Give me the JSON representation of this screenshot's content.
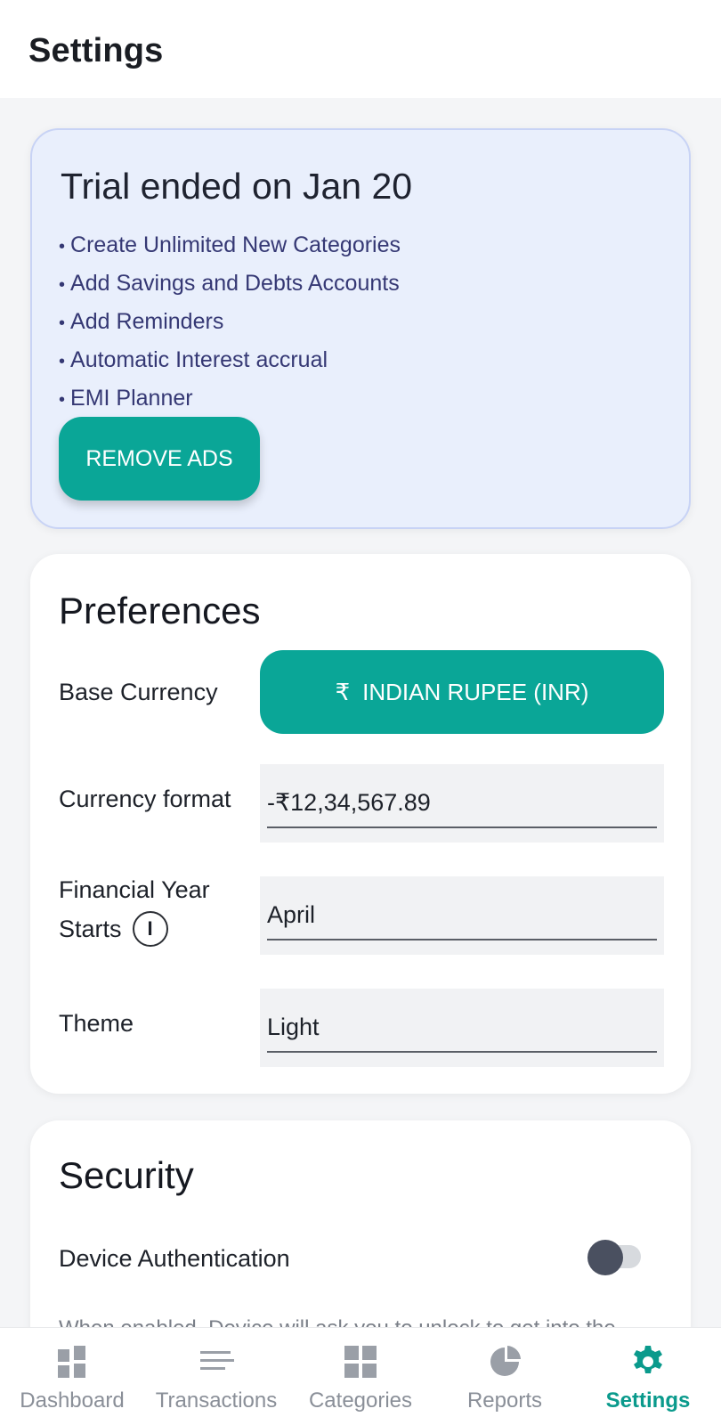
{
  "header": {
    "title": "Settings"
  },
  "trial": {
    "title": "Trial ended on Jan 20",
    "features": [
      "Create Unlimited New Categories",
      "Add Savings and Debts Accounts",
      "Add Reminders",
      "Automatic Interest accrual",
      "EMI Planner"
    ],
    "button_label": "REMOVE ADS"
  },
  "preferences": {
    "title": "Preferences",
    "base_currency_label": "Base Currency",
    "base_currency_symbol": "₹",
    "base_currency_value": "INDIAN RUPEE (INR)",
    "currency_format_label": "Currency format",
    "currency_format_value": "-₹12,34,567.89",
    "financial_year_label_1": "Financial Year",
    "financial_year_label_2": "Starts",
    "info_glyph": "I",
    "financial_year_value": "April",
    "theme_label": "Theme",
    "theme_value": "Light"
  },
  "security": {
    "title": "Security",
    "device_auth_label": "Device Authentication",
    "device_auth_enabled": false,
    "partial_text": "When enabled, Device will ask you to unlock to get into the"
  },
  "nav": {
    "items": [
      {
        "label": "Dashboard",
        "icon": "dashboard-icon",
        "active": false
      },
      {
        "label": "Transactions",
        "icon": "transactions-icon",
        "active": false
      },
      {
        "label": "Categories",
        "icon": "categories-icon",
        "active": false
      },
      {
        "label": "Reports",
        "icon": "reports-icon",
        "active": false
      },
      {
        "label": "Settings",
        "icon": "gear-icon",
        "active": true
      }
    ]
  },
  "colors": {
    "accent": "#0aa697",
    "trial_bg": "#e9effc",
    "trial_text": "#353874",
    "nav_inactive": "#8a8f98",
    "nav_active": "#0a9a8c"
  }
}
